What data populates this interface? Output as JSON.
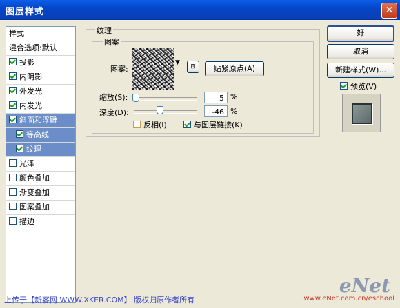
{
  "window": {
    "title": "图层样式"
  },
  "left_panel": {
    "header": "样式",
    "blend": "混合选项:默认",
    "items": [
      {
        "label": "投影",
        "checked": true,
        "selected": false,
        "sub": false
      },
      {
        "label": "内阴影",
        "checked": true,
        "selected": false,
        "sub": false
      },
      {
        "label": "外发光",
        "checked": true,
        "selected": false,
        "sub": false
      },
      {
        "label": "内发光",
        "checked": true,
        "selected": false,
        "sub": false
      },
      {
        "label": "斜面和浮雕",
        "checked": true,
        "selected": true,
        "sub": false
      },
      {
        "label": "等高线",
        "checked": true,
        "selected": true,
        "sub": true
      },
      {
        "label": "纹理",
        "checked": true,
        "selected": true,
        "sub": true
      },
      {
        "label": "光泽",
        "checked": false,
        "selected": false,
        "sub": false
      },
      {
        "label": "颜色叠加",
        "checked": false,
        "selected": false,
        "sub": false
      },
      {
        "label": "渐变叠加",
        "checked": false,
        "selected": false,
        "sub": false
      },
      {
        "label": "图案叠加",
        "checked": false,
        "selected": false,
        "sub": false
      },
      {
        "label": "描边",
        "checked": false,
        "selected": false,
        "sub": false
      }
    ]
  },
  "texture": {
    "group_title": "纹理",
    "subgroup_title": "图案",
    "pattern_label": "图案:",
    "snap_button": "贴紧原点(A)",
    "scale_label": "缩放(S):",
    "scale_value": "5",
    "depth_label": "深度(D):",
    "depth_value": "-46",
    "percent": "%",
    "invert_label": "反相(I)",
    "invert_checked": false,
    "link_label": "与图层链接(K)",
    "link_checked": true
  },
  "buttons": {
    "ok": "好",
    "cancel": "取消",
    "new_style": "新建样式(W)...",
    "preview_label": "预览(V)",
    "preview_checked": true
  },
  "footer": {
    "text": "上传于【新客网 WWW.XKER.COM】 版权归原作者所有",
    "watermark": "eNet",
    "watermark_url": "www.eNet.com.cn/eschool"
  },
  "colors": {
    "title_bar": "#0546c9",
    "selection": "#6c8ec8",
    "dialog_bg": "#ece9d8"
  }
}
